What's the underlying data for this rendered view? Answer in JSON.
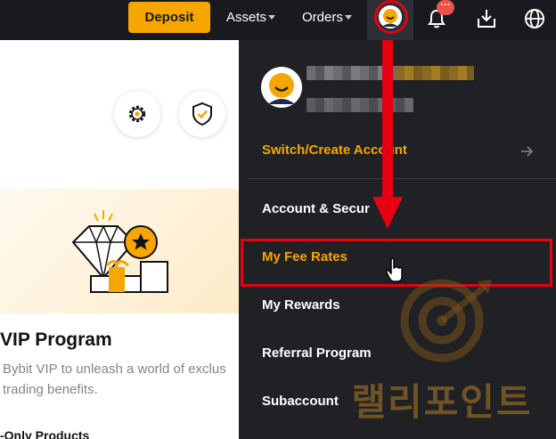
{
  "topbar": {
    "deposit_label": "Deposit",
    "assets_label": "Assets",
    "orders_label": "Orders",
    "notification_badge": "···"
  },
  "background_page": {
    "vip_title": "VIP Program",
    "vip_desc_line1": "Bybit VIP to unleash a world of exclus",
    "vip_desc_line2": "trading benefits.",
    "only_products": "-Only Products"
  },
  "menu": {
    "switch_account": "Switch/Create Account",
    "items": [
      {
        "label": "Account & Secur"
      },
      {
        "label": "My Fee Rates"
      },
      {
        "label": "My Rewards"
      },
      {
        "label": "Referral Program"
      },
      {
        "label": "Subaccount"
      }
    ]
  },
  "watermark": {
    "text": "랠리포인트"
  },
  "colors": {
    "accent": "#f7a600",
    "nav_bg": "#181a20",
    "menu_bg": "#1f2125",
    "annotation_red": "#e60012"
  },
  "icons": [
    "gear-icon",
    "shield-check-icon",
    "bell-icon",
    "download-icon",
    "globe-icon",
    "arrow-right-icon",
    "hand-cursor-icon",
    "avatar-icon"
  ]
}
